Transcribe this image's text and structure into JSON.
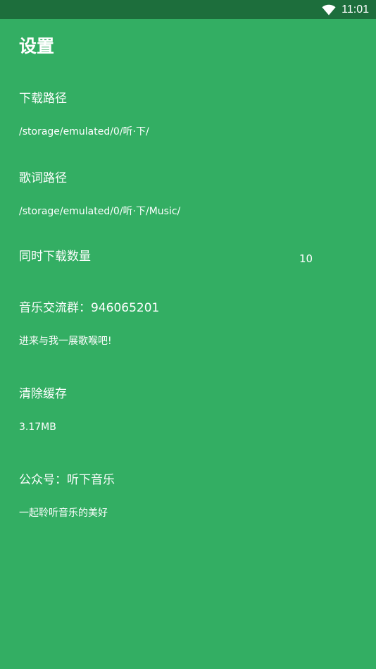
{
  "status_bar": {
    "time": "11:01",
    "icons": [
      "wifi-icon"
    ]
  },
  "header": {
    "title": "设置"
  },
  "settings": [
    {
      "title": "下载路径",
      "subtitle": "/storage/emulated/0/听·下/"
    },
    {
      "title": "歌词路径",
      "subtitle": "/storage/emulated/0/听·下/Music/"
    },
    {
      "title": "同时下载数量",
      "value": "10"
    },
    {
      "title": "音乐交流群：946065201",
      "subtitle": "进来与我一展歌喉吧!"
    },
    {
      "title": "清除缓存",
      "subtitle": "3.17MB"
    },
    {
      "title": "公众号：听下音乐",
      "subtitle": "一起聆听音乐的美好"
    }
  ],
  "colors": {
    "background": "#33ae63",
    "status_bar": "#1d6e3c",
    "text": "#ffffff"
  }
}
